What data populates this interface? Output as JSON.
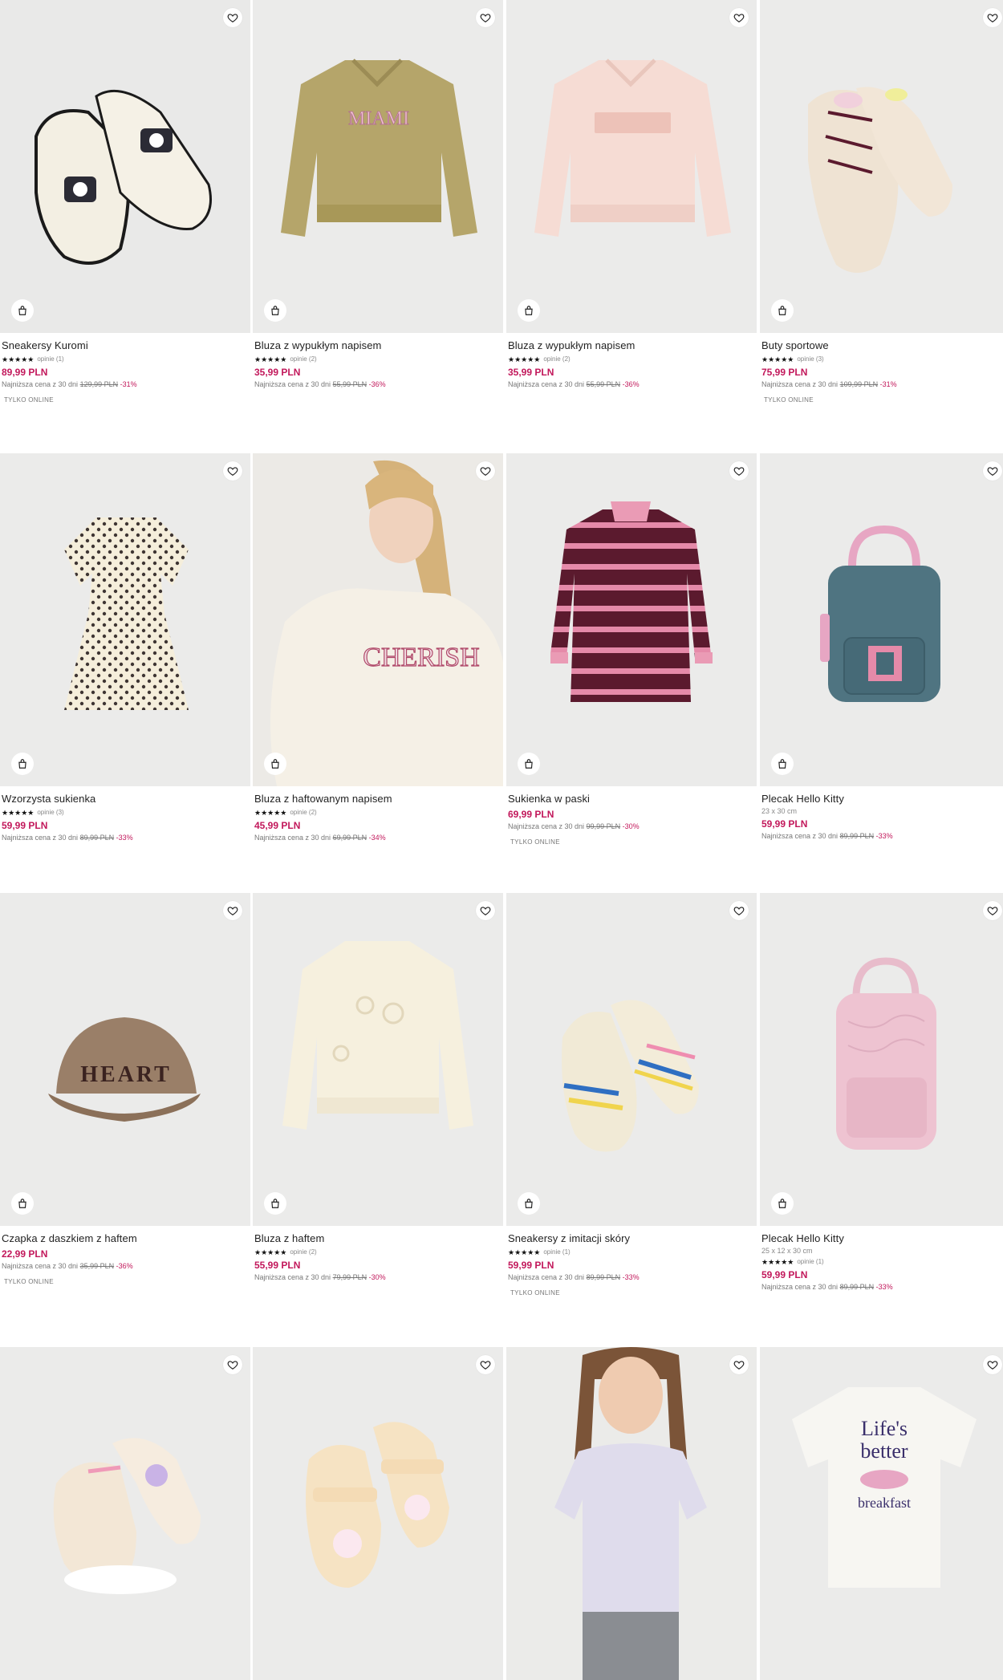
{
  "colors": {
    "price": "#c2185b",
    "tile_bg": "#ececeb",
    "text": "#222222"
  },
  "icons": {
    "wishlist": "heart-icon",
    "add_to_cart": "shopping-bag-icon"
  },
  "products": [
    {
      "name": "Sneakersy Kuromi",
      "dims": "",
      "stars": "★★★★★",
      "reviews": "opinie (1)",
      "price": "89,99 PLN",
      "lowest_label": "Najniższa cena z 30 dni",
      "old_price": "129,99 PLN",
      "discount": "-31%",
      "online": "TYLKO ONLINE",
      "rating_value": 5
    },
    {
      "name": "Bluza z wypukłym napisem",
      "dims": "",
      "stars": "★★★★★",
      "reviews": "opinie (2)",
      "price": "35,99 PLN",
      "lowest_label": "Najniższa cena z 30 dni",
      "old_price": "55,99 PLN",
      "discount": "-36%",
      "online": "",
      "rating_value": 5
    },
    {
      "name": "Bluza z wypukłym napisem",
      "dims": "",
      "stars": "★★★★★",
      "reviews": "opinie (2)",
      "price": "35,99 PLN",
      "lowest_label": "Najniższa cena z 30 dni",
      "old_price": "55,99 PLN",
      "discount": "-36%",
      "online": "",
      "rating_value": 5
    },
    {
      "name": "Buty sportowe",
      "dims": "",
      "stars": "★★★★★",
      "reviews": "opinie (3)",
      "price": "75,99 PLN",
      "lowest_label": "Najniższa cena z 30 dni",
      "old_price": "109,99 PLN",
      "discount": "-31%",
      "online": "TYLKO ONLINE",
      "rating_value": 5
    },
    {
      "name": "Wzorzysta sukienka",
      "dims": "",
      "stars": "★★★★★",
      "reviews": "opinie (3)",
      "price": "59,99 PLN",
      "lowest_label": "Najniższa cena z 30 dni",
      "old_price": "89,99 PLN",
      "discount": "-33%",
      "online": "",
      "rating_value": 5
    },
    {
      "name": "Bluza z haftowanym napisem",
      "dims": "",
      "stars": "★★★★★",
      "reviews": "opinie (2)",
      "price": "45,99 PLN",
      "lowest_label": "Najniższa cena z 30 dni",
      "old_price": "69,99 PLN",
      "discount": "-34%",
      "online": "",
      "rating_value": 5
    },
    {
      "name": "Sukienka w paski",
      "dims": "",
      "stars": "",
      "reviews": "",
      "price": "69,99 PLN",
      "lowest_label": "Najniższa cena z 30 dni",
      "old_price": "99,99 PLN",
      "discount": "-30%",
      "online": "TYLKO ONLINE",
      "rating_value": 0
    },
    {
      "name": "Plecak Hello Kitty",
      "dims": "23 x 30 cm",
      "stars": "",
      "reviews": "",
      "price": "59,99 PLN",
      "lowest_label": "Najniższa cena z 30 dni",
      "old_price": "89,99 PLN",
      "discount": "-33%",
      "online": "",
      "rating_value": 0
    },
    {
      "name": "Czapka z daszkiem z haftem",
      "dims": "",
      "stars": "",
      "reviews": "",
      "price": "22,99 PLN",
      "lowest_label": "Najniższa cena z 30 dni",
      "old_price": "35,99 PLN",
      "discount": "-36%",
      "online": "TYLKO ONLINE",
      "rating_value": 0
    },
    {
      "name": "Bluza z haftem",
      "dims": "",
      "stars": "★★★★★",
      "reviews": "opinie (2)",
      "price": "55,99 PLN",
      "lowest_label": "Najniższa cena z 30 dni",
      "old_price": "79,99 PLN",
      "discount": "-30%",
      "online": "",
      "rating_value": 5
    },
    {
      "name": "Sneakersy z imitacji skóry",
      "dims": "",
      "stars": "★★★★★",
      "reviews": "opinie (1)",
      "price": "59,99 PLN",
      "lowest_label": "Najniższa cena z 30 dni",
      "old_price": "89,99 PLN",
      "discount": "-33%",
      "online": "TYLKO ONLINE",
      "rating_value": 5
    },
    {
      "name": "Plecak Hello Kitty",
      "dims": "25 x 12 x 30 cm",
      "stars": "★★★★★",
      "reviews": "opinie (1)",
      "price": "59,99 PLN",
      "lowest_label": "Najniższa cena z 30 dni",
      "old_price": "89,99 PLN",
      "discount": "-33%",
      "online": "",
      "rating_value": 5
    },
    {
      "name": "",
      "dims": "",
      "stars": "",
      "reviews": "",
      "price": "",
      "lowest_label": "",
      "old_price": "",
      "discount": "",
      "online": ""
    },
    {
      "name": "",
      "dims": "",
      "stars": "",
      "reviews": "",
      "price": "",
      "lowest_label": "",
      "old_price": "",
      "discount": "",
      "online": ""
    },
    {
      "name": "",
      "dims": "",
      "stars": "",
      "reviews": "",
      "price": "",
      "lowest_label": "",
      "old_price": "",
      "discount": "",
      "online": ""
    },
    {
      "name": "",
      "dims": "",
      "stars": "",
      "reviews": "",
      "price": "",
      "lowest_label": "",
      "old_price": "",
      "discount": "",
      "online": ""
    }
  ],
  "image_prints": {
    "p1": "MIAMI",
    "p5": "CHERISH",
    "p8": "HEART",
    "p15_line1": "Life's",
    "p15_line2": "better",
    "p15_line3": "breakfast"
  }
}
